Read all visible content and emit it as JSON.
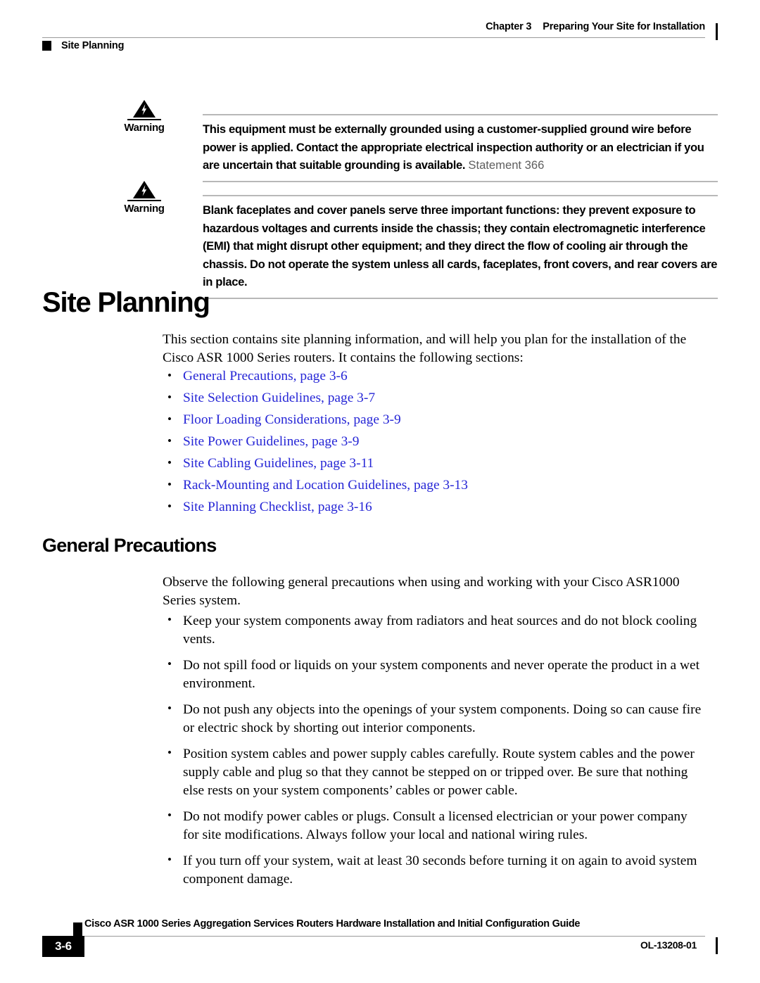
{
  "header": {
    "chapter": "Chapter 3",
    "chapter_title": "Preparing Your Site for Installation",
    "section": "Site Planning"
  },
  "warnings": [
    {
      "label": "Warning",
      "icon": "warning-triangle-lightning-icon",
      "text": "This equipment must be externally grounded using a customer-supplied ground wire before power is applied. Contact the appropriate electrical inspection authority or an electrician if you are uncertain that suitable grounding is available.",
      "statement": "Statement 366"
    },
    {
      "label": "Warning",
      "icon": "warning-triangle-lightning-icon",
      "text": "Blank faceplates and cover panels serve three important functions: they prevent exposure to hazardous voltages and currents inside the chassis; they contain electromagnetic interference (EMI) that might disrupt other equipment; and they direct the flow of cooling air through the chassis. Do not operate the system unless all cards, faceplates, front covers, and rear covers are in place.",
      "statement": ""
    }
  ],
  "site_planning": {
    "heading": "Site Planning",
    "intro": "This section contains site planning information, and will help you plan for the installation of the Cisco ASR 1000 Series routers. It contains the following sections:",
    "links": [
      "General Precautions, page 3-6",
      "Site Selection Guidelines, page 3-7",
      "Floor Loading Considerations, page 3-9",
      "Site Power Guidelines, page 3-9",
      "Site Cabling Guidelines, page 3-11",
      "Rack-Mounting and Location Guidelines, page 3-13",
      "Site Planning Checklist, page 3-16"
    ]
  },
  "general_precautions": {
    "heading": "General Precautions",
    "intro": "Observe the following general precautions when using and working with your Cisco ASR1000 Series system.",
    "bullets": [
      "Keep your system components away from radiators and heat sources and do not block cooling vents.",
      "Do not spill food or liquids on your system components and never operate the product in a wet environment.",
      "Do not push any objects into the openings of your system components. Doing so can cause fire or electric shock by shorting out interior components.",
      "Position system cables and power supply cables carefully. Route system cables and the power supply cable and plug so that they cannot be stepped on or tripped over. Be sure that nothing else rests on your system components’ cables or power cable.",
      "Do not modify power cables or plugs. Consult a licensed electrician or your power company for site modifications. Always follow your local and national wiring rules.",
      "If you turn off your system, wait at least 30 seconds before turning it on again to avoid system component damage."
    ]
  },
  "footer": {
    "doc_title": "Cisco ASR 1000 Series Aggregation Services Routers Hardware Installation and Initial Configuration Guide",
    "page_number": "3-6",
    "doc_id": "OL-13208-01"
  },
  "colors": {
    "link": "#2626d6",
    "text": "#000000",
    "rule": "#9a9a9a",
    "statement": "#5e5e5e"
  }
}
